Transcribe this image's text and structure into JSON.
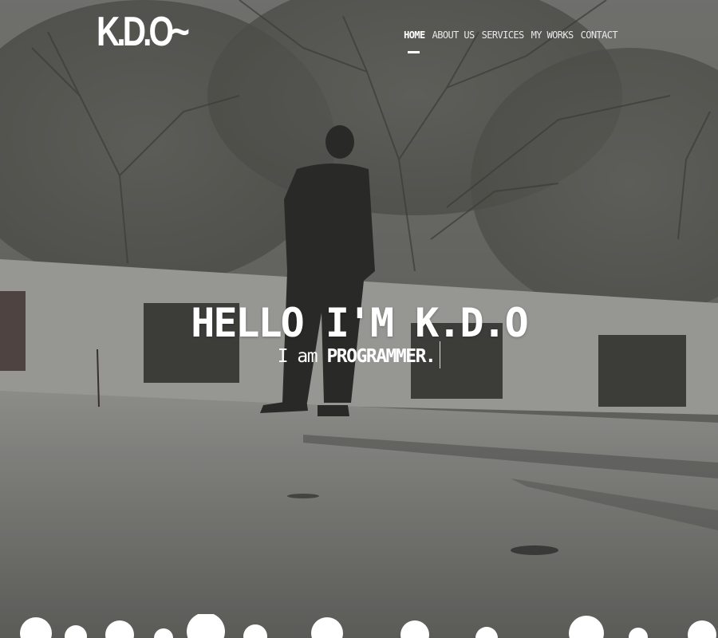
{
  "site": {
    "logo": "K.D.O~"
  },
  "nav": {
    "items": [
      {
        "label": "HOME",
        "active": true
      },
      {
        "label": "ABOUT US",
        "active": false
      },
      {
        "label": "SERVICES",
        "active": false
      },
      {
        "label": "MY WORKS",
        "active": false
      },
      {
        "label": "CONTACT",
        "active": false
      }
    ]
  },
  "hero": {
    "headline": "HELLO I'M K.D.O",
    "tagline_prefix": "I am",
    "tagline_role": "PROGRAMMER."
  },
  "colors": {
    "text": "#ffffff",
    "overlay": "#373734",
    "cloud": "#ffffff"
  }
}
